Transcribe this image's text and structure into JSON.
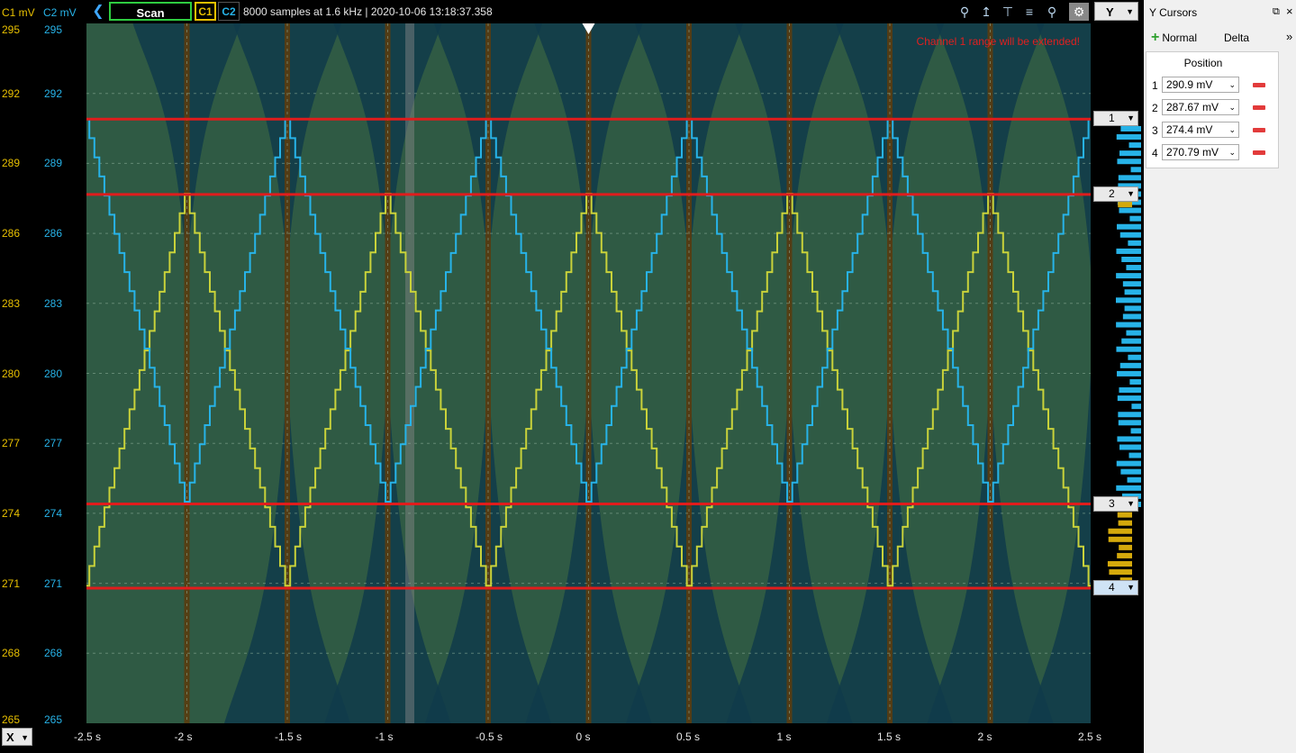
{
  "toolbar": {
    "scan_label": "Scan",
    "c1_label": "C1",
    "c2_label": "C2",
    "status": "8000 samples at 1.6 kHz | 2020-10-06 13:18:37.358",
    "y_axis_select": "Y",
    "icons": [
      "zoom-search-icon",
      "cursor-up-icon",
      "cursor-h-icon",
      "cursor-lines-icon",
      "zoom-icon",
      "settings-gear-icon"
    ]
  },
  "axes": {
    "c1_unit_label": "C1 mV",
    "c2_unit_label": "C2 mV",
    "y_ticks": [
      "295",
      "292",
      "289",
      "286",
      "283",
      "280",
      "277",
      "274",
      "271",
      "268",
      "265"
    ],
    "x_ticks": [
      "-2.5 s",
      "-2 s",
      "-1.5 s",
      "-1 s",
      "-0.5 s",
      "0 s",
      "0.5 s",
      "1 s",
      "1.5 s",
      "2 s",
      "2.5 s"
    ],
    "x_select": "X"
  },
  "plot": {
    "warning": "Channel 1 range will be extended!",
    "colors": {
      "background": "#2f5a44",
      "c1": "#c9d23a",
      "c2": "#27b3e8",
      "cursor": "#e01c1c"
    }
  },
  "chart_data": {
    "type": "line",
    "x_range": [
      -2.5,
      2.5
    ],
    "y_range": [
      265,
      295
    ],
    "series": [
      {
        "name": "C1",
        "shape": "triangle",
        "period": 1.0,
        "min": 270.9,
        "max": 287.7,
        "peak_times": [
          -2.0,
          -1.0,
          0.0,
          1.0,
          2.0
        ]
      },
      {
        "name": "C2",
        "shape": "triangle",
        "period": 1.0,
        "min": 274.5,
        "max": 290.9,
        "peak_times": [
          -1.5,
          -0.5,
          0.5,
          1.5,
          2.5
        ]
      }
    ],
    "cursors": [
      290.9,
      287.67,
      274.4,
      270.79
    ]
  },
  "cursor_tags": [
    "1",
    "2",
    "3",
    "4"
  ],
  "panel": {
    "title": "Y Cursors",
    "add_normal": "Normal",
    "add_delta": "Delta",
    "position_header": "Position",
    "rows": [
      {
        "index": "1",
        "value": "290.9 mV"
      },
      {
        "index": "2",
        "value": "287.67 mV"
      },
      {
        "index": "3",
        "value": "274.4 mV"
      },
      {
        "index": "4",
        "value": "270.79 mV"
      }
    ]
  }
}
